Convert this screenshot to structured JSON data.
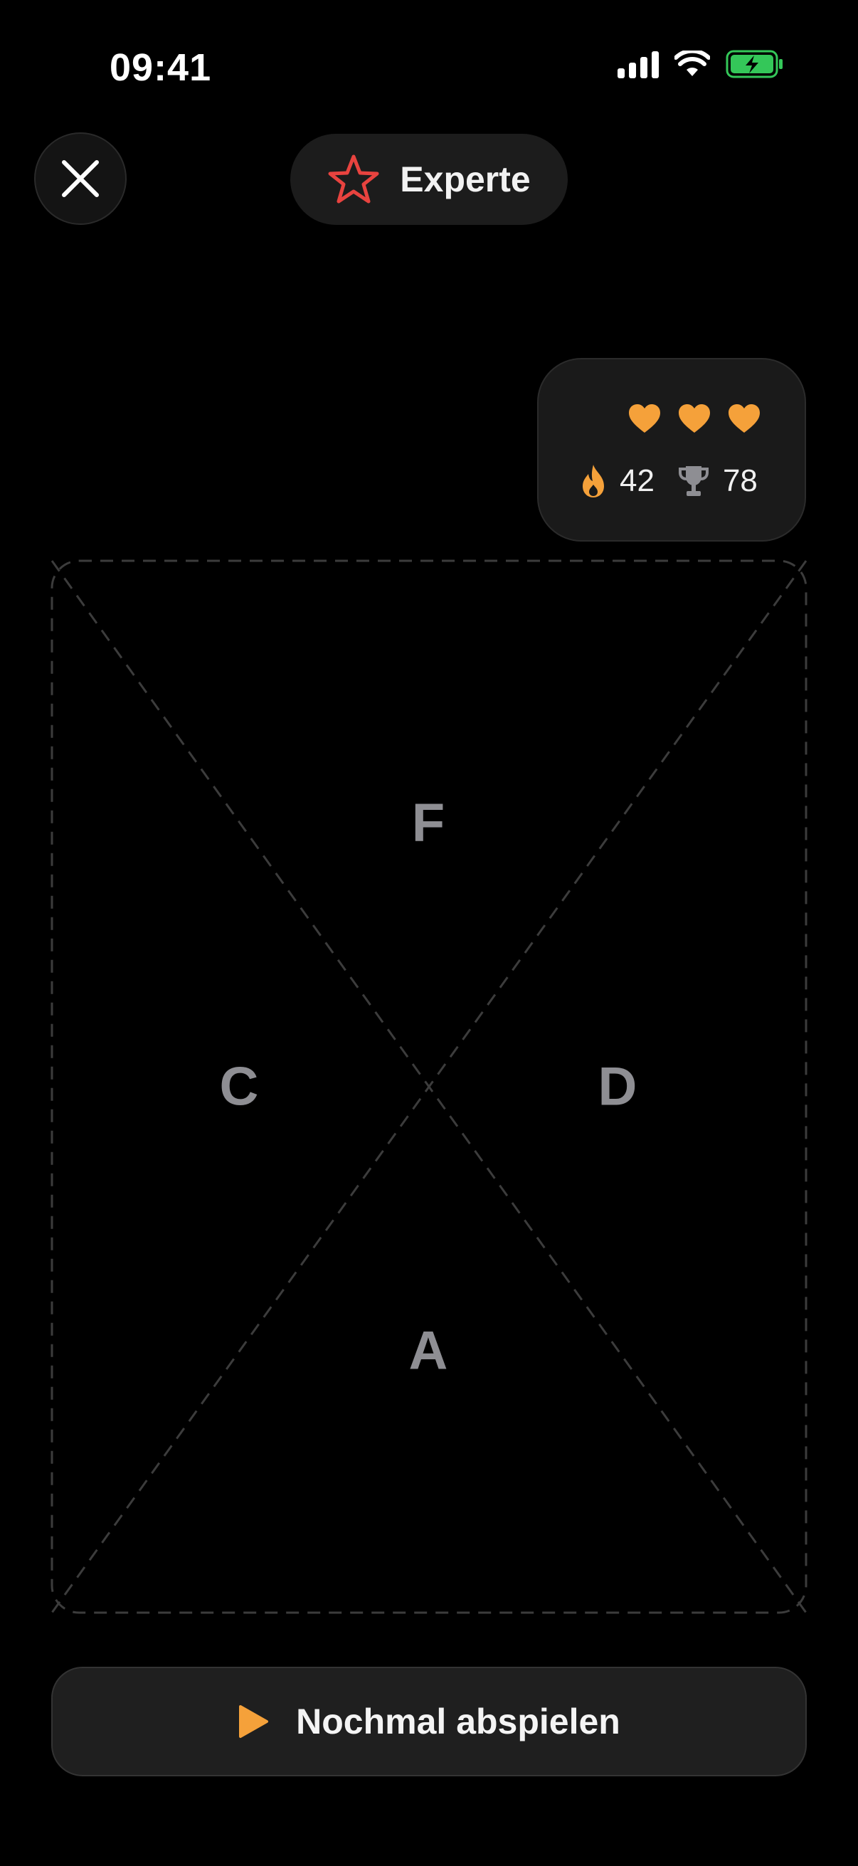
{
  "status_bar": {
    "time": "09:41",
    "battery_color": "#34c759"
  },
  "header": {
    "difficulty": "Experte",
    "difficulty_icon": "star-icon",
    "close_icon": "close-icon"
  },
  "stats": {
    "lives": 3,
    "streak": "42",
    "best": "78",
    "accent_color": "#f5a13a"
  },
  "board": {
    "zones": {
      "top": "F",
      "left": "C",
      "right": "D",
      "bottom": "A"
    }
  },
  "replay": {
    "label": "Nochmal abspielen",
    "icon": "play-icon"
  }
}
